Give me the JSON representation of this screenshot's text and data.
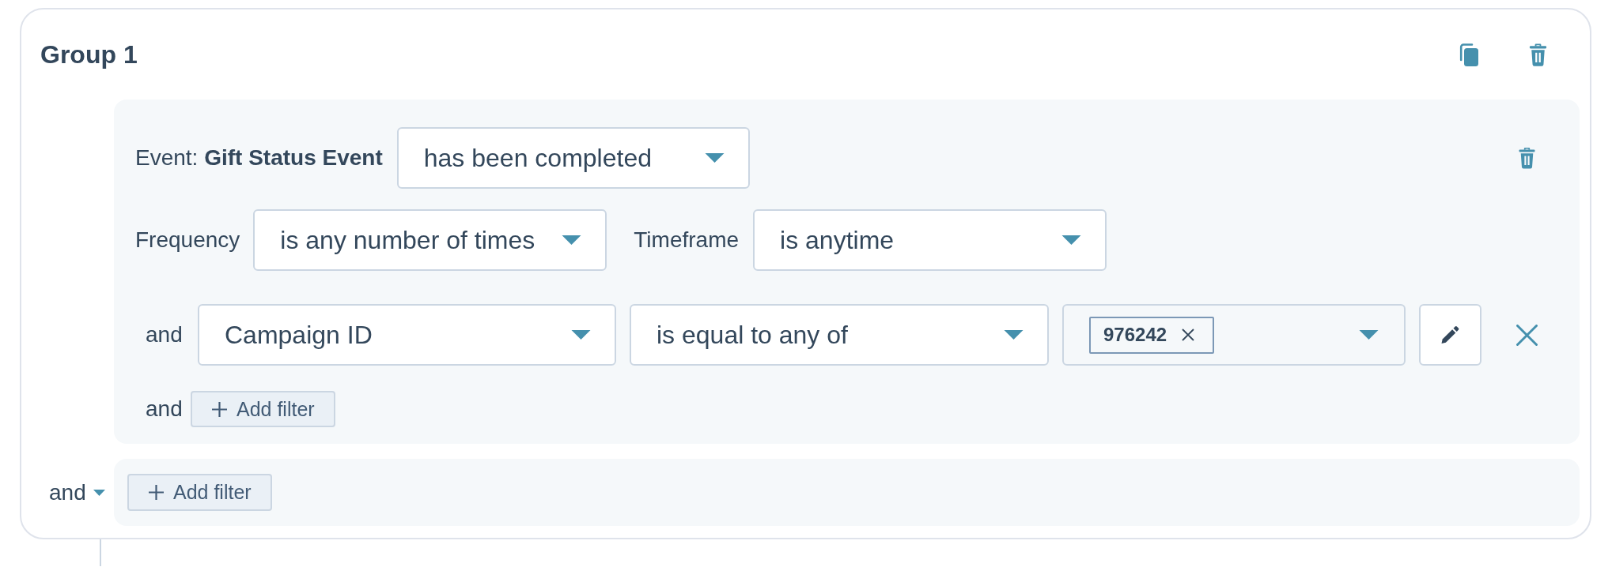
{
  "group": {
    "title": "Group 1"
  },
  "event_filter": {
    "event_label": "Event: **Gift Status Event**",
    "status": "has been completed",
    "frequency": {
      "label": "Frequency",
      "value": "is any number of times"
    },
    "timeframe": {
      "label": "Timeframe",
      "value": "is anytime"
    },
    "conditions": [
      {
        "connector": "and",
        "property": "Campaign ID",
        "operator": "is equal to any of",
        "values": [
          "976242"
        ]
      }
    ],
    "add_filter": {
      "connector": "and",
      "label": "Add filter"
    }
  },
  "group_footer": {
    "connector": "and",
    "add_filter_label": "Add filter"
  }
}
